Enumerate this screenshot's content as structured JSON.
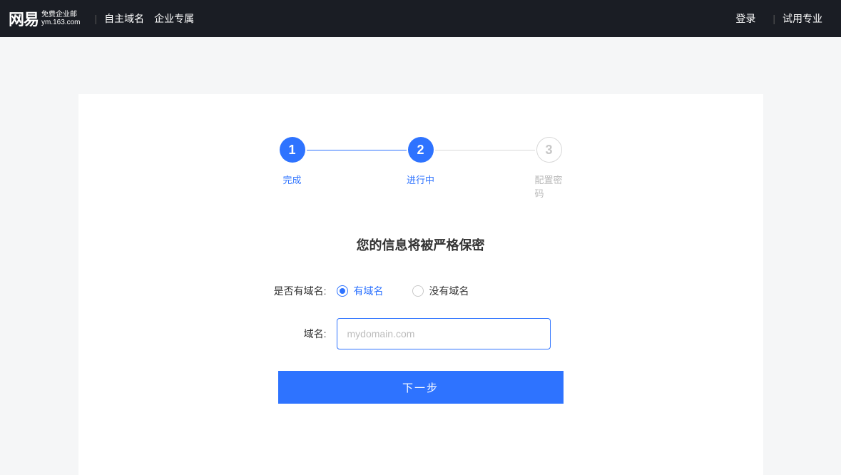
{
  "header": {
    "logo_main": "网易",
    "logo_sub1": "免费企业邮",
    "logo_sub2": "ym.163.com",
    "nav1": "自主域名",
    "nav2": "企业专属",
    "login": "登录",
    "trial": "试用专业"
  },
  "steps": [
    {
      "num": "1",
      "label": "完成"
    },
    {
      "num": "2",
      "label": "进行中"
    },
    {
      "num": "3",
      "label": "配置密码"
    }
  ],
  "form": {
    "heading": "您的信息将被严格保密",
    "has_domain_label": "是否有域名:",
    "option_yes": "有域名",
    "option_no": "没有域名",
    "domain_label": "域名:",
    "domain_placeholder": "mydomain.com",
    "submit": "下一步"
  }
}
